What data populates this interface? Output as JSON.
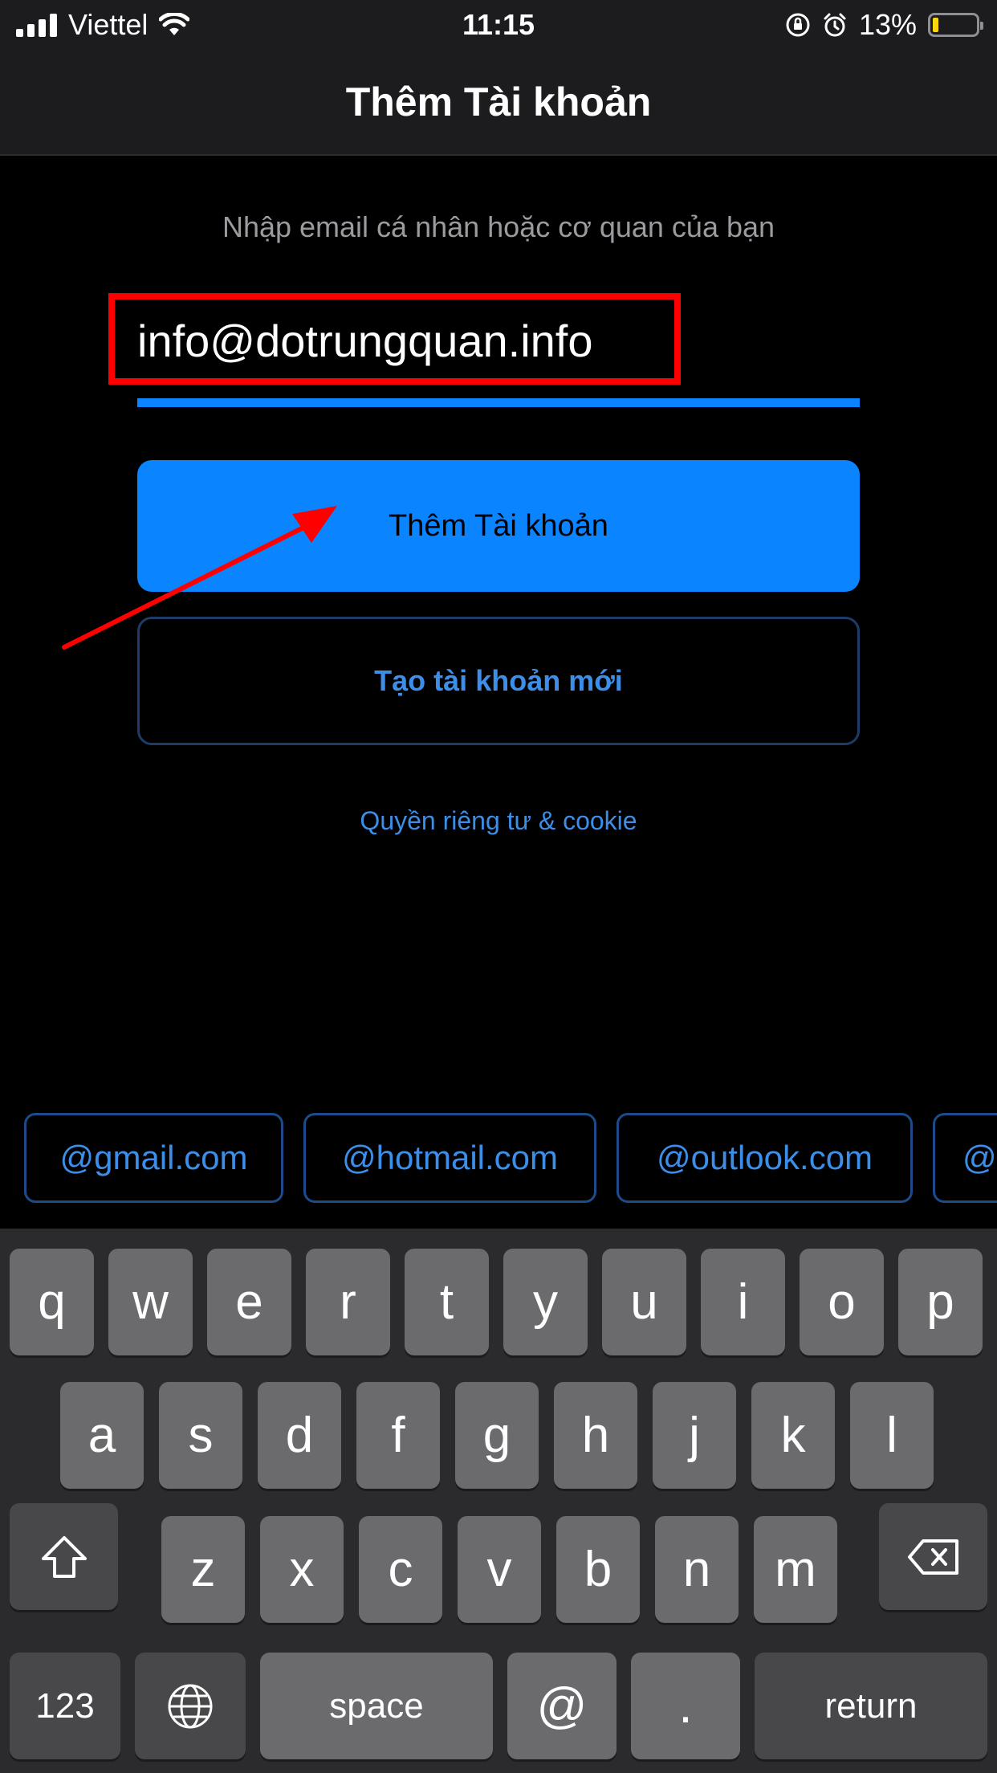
{
  "status_bar": {
    "carrier": "Viettel",
    "time": "11:15",
    "battery": "13%",
    "battery_level": 0.13
  },
  "nav": {
    "title": "Thêm Tài khoản"
  },
  "form": {
    "prompt": "Nhập email cá nhân hoặc cơ quan của bạn",
    "email_value": "info@dotrungquan.info",
    "add_account_label": "Thêm Tài khoản",
    "create_account_label": "Tạo tài khoản mới",
    "privacy_label": "Quyền riêng tư & cookie"
  },
  "suggestions": [
    "@gmail.com",
    "@hotmail.com",
    "@outlook.com",
    "@"
  ],
  "keyboard": {
    "row1": [
      "q",
      "w",
      "e",
      "r",
      "t",
      "y",
      "u",
      "i",
      "o",
      "p"
    ],
    "row2": [
      "a",
      "s",
      "d",
      "f",
      "g",
      "h",
      "j",
      "k",
      "l"
    ],
    "row3": [
      "z",
      "x",
      "c",
      "v",
      "b",
      "n",
      "m"
    ],
    "numbers": "123",
    "space": "space",
    "at": "@",
    "dot": ".",
    "return": "return"
  },
  "colors": {
    "accent": "#0a84ff",
    "annotation": "#ff0000",
    "background": "#000000"
  }
}
